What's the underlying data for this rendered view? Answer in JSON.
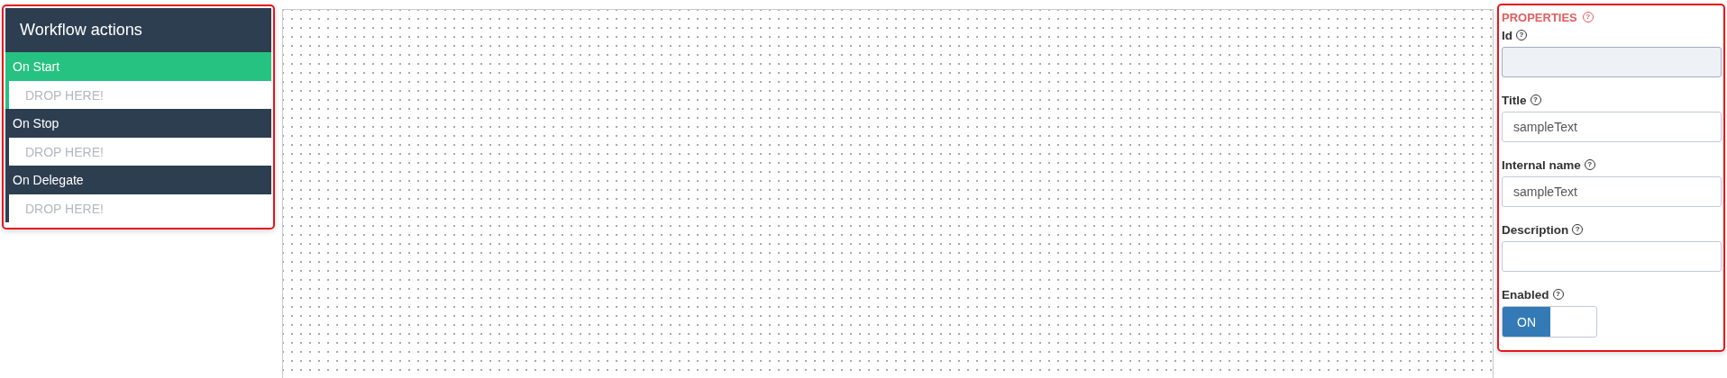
{
  "actions_panel": {
    "title": "Workflow actions",
    "actions": [
      {
        "label": "On Start",
        "selected": true,
        "drop_text": "DROP HERE!"
      },
      {
        "label": "On Stop",
        "selected": false,
        "drop_text": "DROP HERE!"
      },
      {
        "label": "On Delegate",
        "selected": false,
        "drop_text": "DROP HERE!"
      }
    ]
  },
  "properties": {
    "title": "PROPERTIES",
    "help_mark": "?",
    "fields": [
      {
        "kind": "text",
        "label": "Id",
        "disabled": true
      },
      {
        "kind": "text",
        "label": "Title",
        "value": "sampleText",
        "disabled": false
      },
      {
        "kind": "text",
        "label": "Internal name",
        "value": "sampleText",
        "disabled": false
      },
      {
        "kind": "text",
        "label": "Description",
        "disabled": false
      },
      {
        "kind": "toggle",
        "label": "Enabled",
        "on": true,
        "on_text": "ON"
      }
    ]
  }
}
